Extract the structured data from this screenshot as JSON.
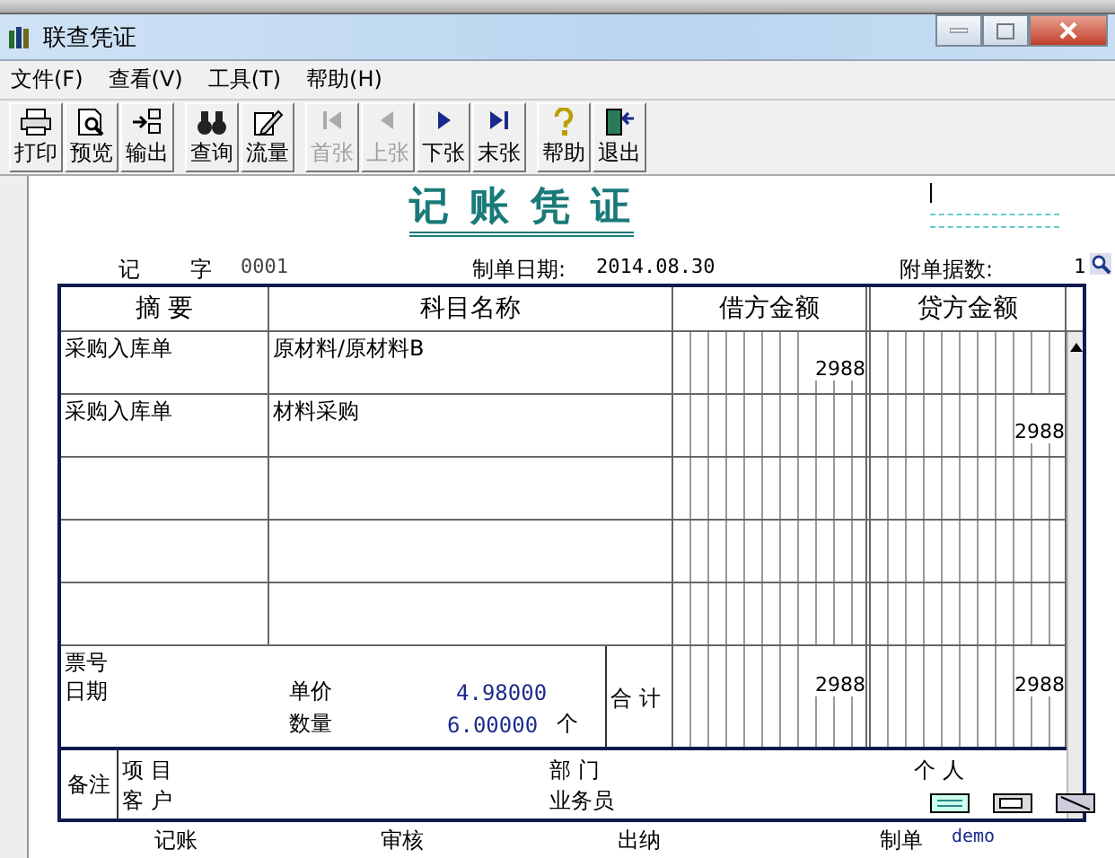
{
  "window": {
    "title": "联查凭证"
  },
  "menu": [
    "文件(F)",
    "查看(V)",
    "工具(T)",
    "帮助(H)"
  ],
  "toolbar": [
    [
      {
        "label": "打印",
        "kind": "print",
        "disabled": false
      },
      {
        "label": "预览",
        "kind": "preview",
        "disabled": false
      },
      {
        "label": "输出",
        "kind": "export",
        "disabled": false
      }
    ],
    [
      {
        "label": "查询",
        "kind": "binoculars",
        "disabled": false
      },
      {
        "label": "流量",
        "kind": "pen",
        "disabled": false
      }
    ],
    [
      {
        "label": "首张",
        "kind": "first",
        "disabled": true
      },
      {
        "label": "上张",
        "kind": "prev",
        "disabled": true
      },
      {
        "label": "下张",
        "kind": "next",
        "disabled": false
      },
      {
        "label": "末张",
        "kind": "last",
        "disabled": false
      }
    ],
    [
      {
        "label": "帮助",
        "kind": "help",
        "disabled": false
      },
      {
        "label": "退出",
        "kind": "exit",
        "disabled": false
      }
    ]
  ],
  "voucher": {
    "title": "记 账 凭 证",
    "type": "记",
    "type_suffix": "字",
    "number": "0001",
    "date_label": "制单日期:",
    "date": "2014.08.30",
    "attachments_label": "附单据数:",
    "attachments": "1",
    "columns": [
      "摘 要",
      "科目名称",
      "借方金额",
      "贷方金额"
    ],
    "rows": [
      {
        "summary": "采购入库单",
        "account": "原材料/原材料B",
        "debit": "2988"
      },
      {
        "summary": "采购入库单",
        "account": "材料采购",
        "credit": "2988"
      },
      {},
      {},
      {}
    ],
    "ticket_label": "票号",
    "date_field_label": "日期",
    "unit_price_label": "单价",
    "unit_price": "4.98000",
    "quantity_label": "数量",
    "quantity": "6.00000",
    "unit": "个",
    "total_label": "合 计",
    "total_debit": "2988",
    "total_credit": "2988",
    "remarks_label": "备注",
    "project_label": "项 目",
    "customer_label": "客 户",
    "department_label": "部 门",
    "salesperson_label": "业务员",
    "person_label": "个 人",
    "footer": [
      {
        "label": "记账"
      },
      {
        "label": "审核"
      },
      {
        "label": "出纳"
      },
      {
        "label": "制单",
        "value": "demo"
      }
    ]
  }
}
